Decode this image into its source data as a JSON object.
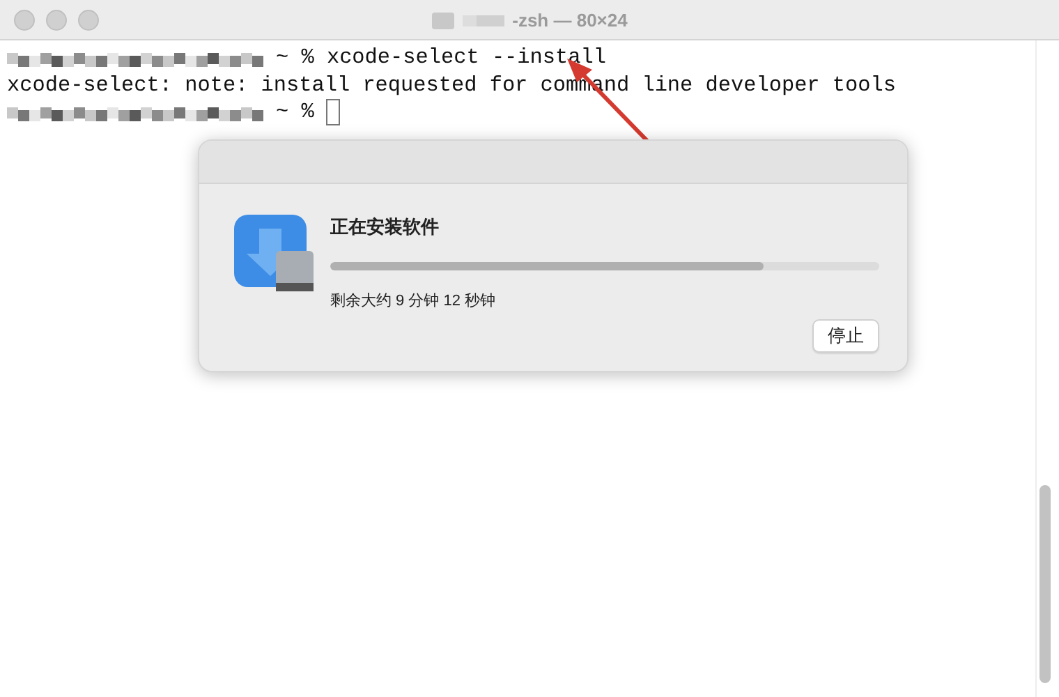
{
  "window": {
    "title": "-zsh — 80×24"
  },
  "terminal": {
    "lines": [
      {
        "kind": "prompt",
        "text": "~ % xcode-select --install"
      },
      {
        "kind": "output",
        "text": "xcode-select: note: install requested for command line developer tools"
      },
      {
        "kind": "prompt",
        "text": "~ %"
      }
    ]
  },
  "dialog": {
    "title": "正在安装软件",
    "progress": {
      "level": 0.79
    },
    "status": "剩余大约 9 分钟 12 秒钟",
    "buttons": [
      "停止"
    ]
  }
}
